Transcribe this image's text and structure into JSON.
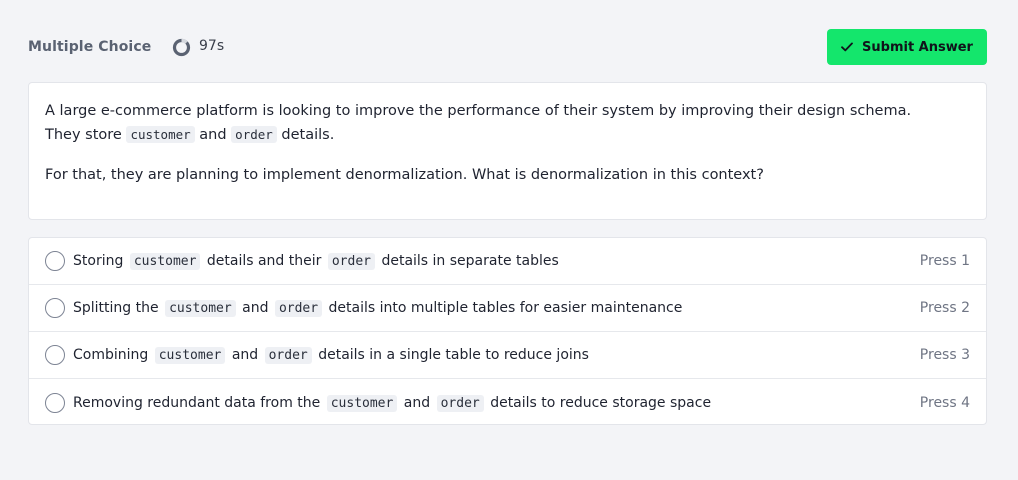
{
  "header": {
    "title": "Multiple Choice",
    "timer_icon": "loading-ring-icon",
    "timer": "97s",
    "submit_icon": "check-icon",
    "submit_label": "Submit Answer",
    "accent_color": "#14e66c"
  },
  "question": {
    "line1": "A large e-commerce platform is looking to improve the performance of their system by improving their design schema.",
    "line2_a": "They store",
    "code_customer": "customer",
    "line2_b": "and",
    "code_order": "order",
    "line2_c": "details.",
    "line3": "For that, they are planning to implement denormalization. What is denormalization in this context?"
  },
  "options": [
    {
      "pre": "Storing",
      "code1": "customer",
      "mid": "details and their",
      "code2": "order",
      "post": "details in separate tables",
      "press": "Press 1"
    },
    {
      "pre": "Splitting the",
      "code1": "customer",
      "mid": "and",
      "code2": "order",
      "post": "details into multiple tables for easier maintenance",
      "press": "Press 2"
    },
    {
      "pre": "Combining",
      "code1": "customer",
      "mid": "and",
      "code2": "order",
      "post": "details in a single table to reduce joins",
      "press": "Press 3"
    },
    {
      "pre": "Removing redundant data from the",
      "code1": "customer",
      "mid": "and",
      "code2": "order",
      "post": "details to reduce storage space",
      "press": "Press 4"
    }
  ]
}
